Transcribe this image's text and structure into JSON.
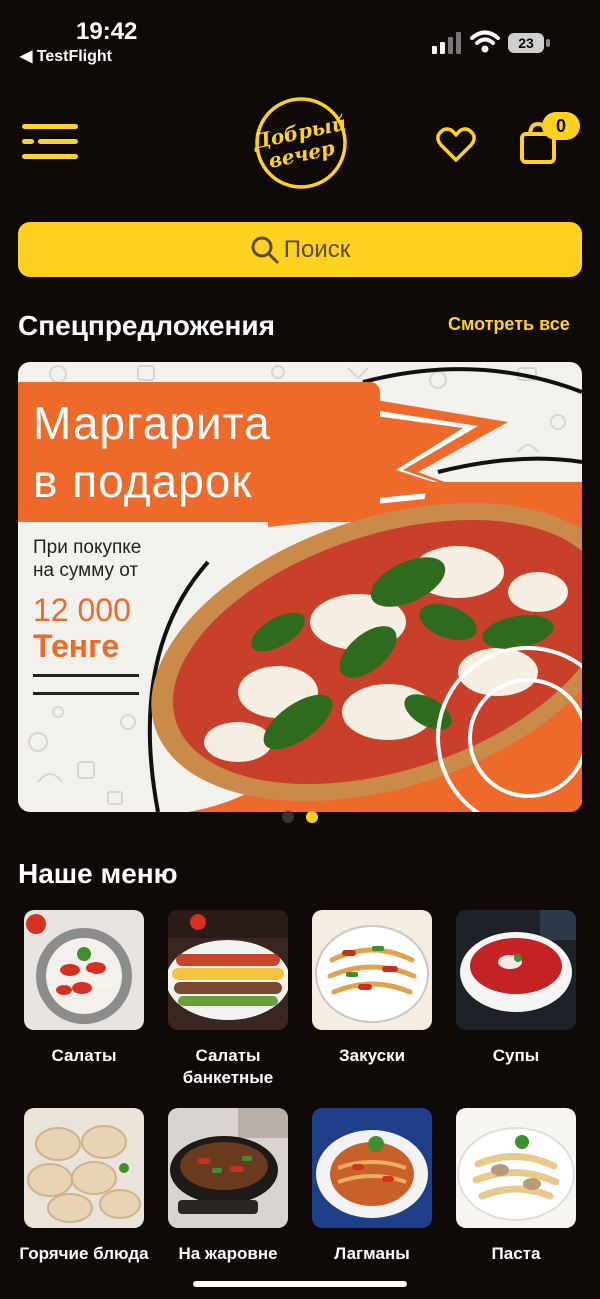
{
  "status": {
    "time": "19:42",
    "back_app": "◀ TestFlight",
    "battery": "23"
  },
  "header": {
    "logo_line1": "Добрый",
    "logo_line2": "вечер",
    "cart_count": "0"
  },
  "search": {
    "placeholder": "Поиск"
  },
  "specials": {
    "title": "Спецпредложения",
    "see_all": "Смотреть все",
    "banner": {
      "title_line1": "Маргарита",
      "title_line2": "в подарок",
      "subtitle_line1": "При покупке",
      "subtitle_line2": "на сумму от",
      "amount": "12 000",
      "currency": "Тенге"
    },
    "page_count": 2,
    "active_page": 2
  },
  "menu": {
    "title": "Наше меню",
    "categories": [
      {
        "label": "Салаты"
      },
      {
        "label": "Салаты банкетные"
      },
      {
        "label": "Закуски"
      },
      {
        "label": "Супы"
      },
      {
        "label": "Горячие блюда"
      },
      {
        "label": "На жаровне"
      },
      {
        "label": "Лагманы"
      },
      {
        "label": "Паста"
      }
    ]
  },
  "colors": {
    "accent": "#ffd21f",
    "background": "#0f0908",
    "banner_orange": "#ee6a2a"
  }
}
